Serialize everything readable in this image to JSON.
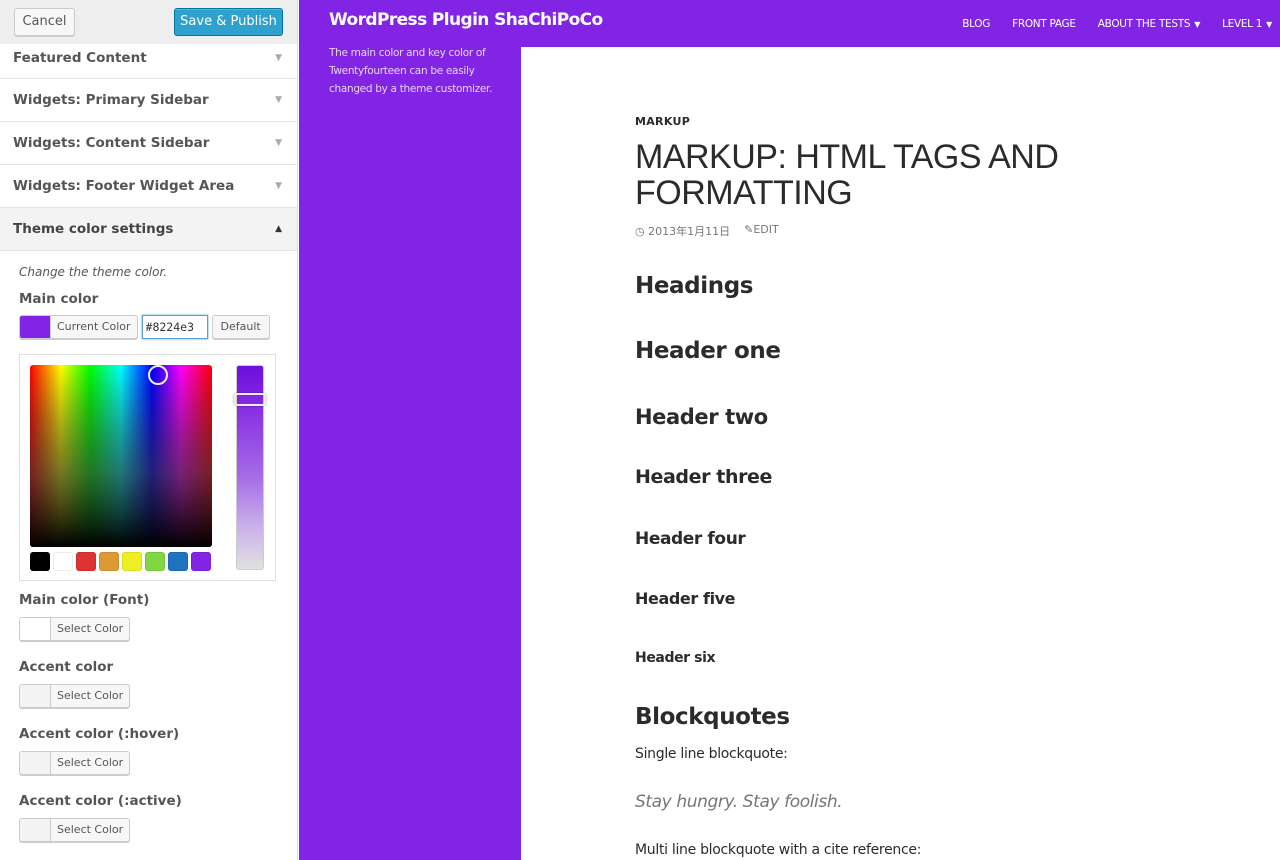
{
  "sidebar": {
    "cancel_label": "Cancel",
    "save_label": "Save & Publish",
    "sections": [
      {
        "label": "Featured Content",
        "arrow": "▼"
      },
      {
        "label": "Widgets: Primary Sidebar",
        "arrow": "▼"
      },
      {
        "label": "Widgets: Content Sidebar",
        "arrow": "▼"
      },
      {
        "label": "Widgets: Footer Widget Area",
        "arrow": "▼"
      },
      {
        "label": "Theme color settings",
        "arrow": "▲"
      }
    ],
    "theme_color": {
      "description": "Change the theme color.",
      "main_color": {
        "label": "Main color",
        "button_label": "Current Color",
        "value": "#8224e3",
        "hex_input_value": "#8224e3",
        "default_label": "Default"
      },
      "palette": [
        "#000000",
        "#ffffff",
        "#dd3333",
        "#dd9933",
        "#eeee22",
        "#81d742",
        "#1e73be",
        "#8224e3"
      ],
      "other_controls": [
        {
          "label": "Main color (Font)",
          "button_label": "Select Color"
        },
        {
          "label": "Accent color",
          "button_label": "Select Color"
        },
        {
          "label": "Accent color (:hover)",
          "button_label": "Select Color"
        },
        {
          "label": "Accent color (:active)",
          "button_label": "Select Color"
        }
      ]
    }
  },
  "preview": {
    "brand_color": "#8224e3",
    "site_title": "WordPress Plugin ShaChiPoCo",
    "site_description": "The main color and key color of Twentyfourteen can be easily changed by a theme customizer.",
    "nav": [
      {
        "label": "BLOG",
        "has_dropdown": false
      },
      {
        "label": "FRONT PAGE",
        "has_dropdown": false
      },
      {
        "label": "ABOUT THE TESTS",
        "has_dropdown": true
      },
      {
        "label": "LEVEL 1",
        "has_dropdown": true
      }
    ],
    "post": {
      "category": "MARKUP",
      "title": "MARKUP: HTML TAGS AND FORMATTING",
      "date": "2013年1月11日",
      "edit_label": "EDIT",
      "headings": {
        "headings": "Headings",
        "h1": "Header one",
        "h2": "Header two",
        "h3": "Header three",
        "h4": "Header four",
        "h5": "Header five",
        "h6": "Header six",
        "blockquotes": "Blockquotes"
      },
      "single_line_label": "Single line blockquote:",
      "quote": "Stay hungry. Stay foolish.",
      "multi_line_label": "Multi line blockquote with a cite reference:"
    }
  }
}
